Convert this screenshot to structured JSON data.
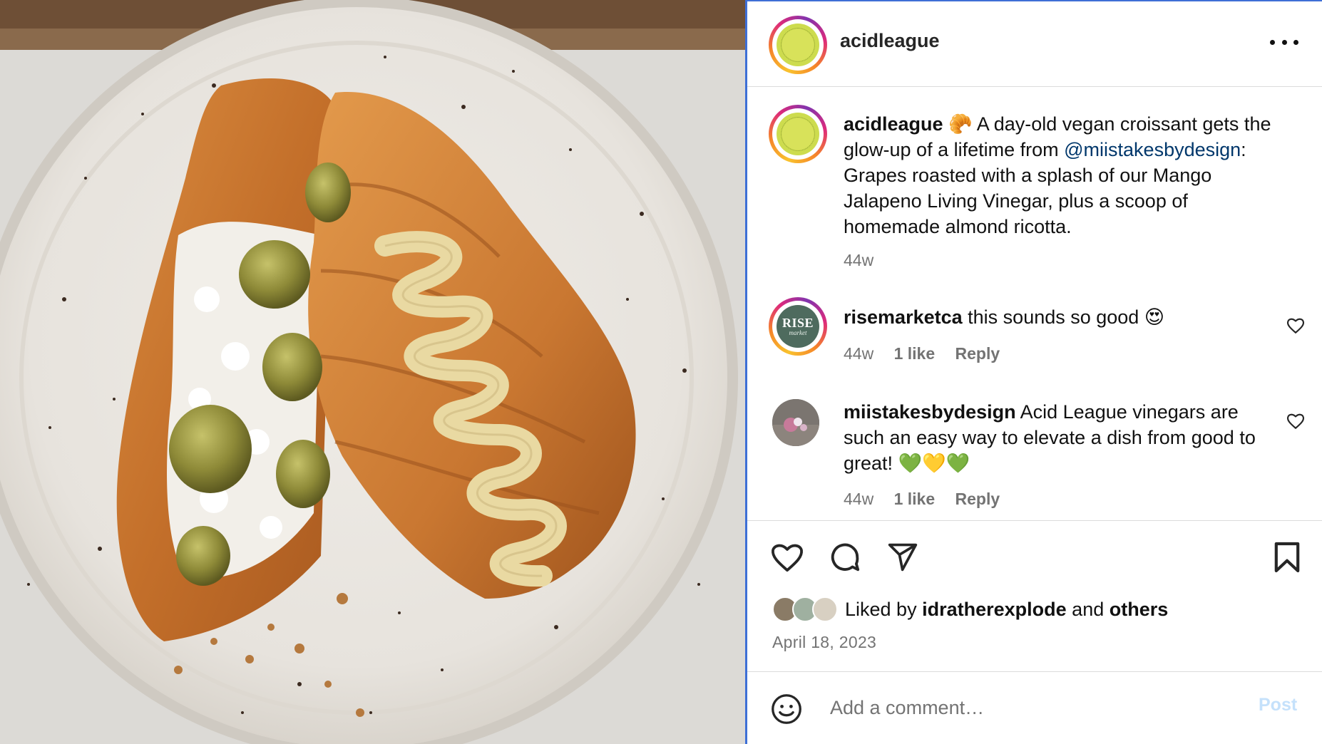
{
  "post": {
    "username": "acidleague",
    "caption_emoji": "🥐",
    "caption_part1": "A day-old vegan croissant gets the glow-up of a lifetime from",
    "caption_mention": "@miistakesbydesign",
    "caption_part2": ": Grapes roasted with a splash of our Mango Jalapeno Living Vinegar, plus a scoop of homemade almond ricotta.",
    "age": "44w"
  },
  "comments": [
    {
      "username": "risemarketca",
      "text": "this sounds so good",
      "emoji": "😍",
      "avatar_text": "RISE",
      "avatar_subtext": "market",
      "age": "44w",
      "likes": "1 like",
      "reply": "Reply"
    },
    {
      "username": "miistakesbydesign",
      "text": "Acid League vinegars are such an easy way to elevate a dish from good to great!",
      "emoji": "💚💛💚",
      "age": "44w",
      "likes": "1 like",
      "reply": "Reply"
    }
  ],
  "likes": {
    "prefix": "Liked by",
    "user": "idratherexplode",
    "conj": "and",
    "others": "others"
  },
  "date": "April 18, 2023",
  "comment_box": {
    "placeholder": "Add a comment…",
    "post_label": "Post"
  },
  "icons": {
    "more": "more-horizontal-icon",
    "like": "heart-icon",
    "comment": "comment-bubble-icon",
    "share": "paper-plane-icon",
    "save": "bookmark-icon",
    "emoji": "smiley-icon"
  },
  "colors": {
    "accent_focus": "#3e6fd6",
    "mention": "#00376b",
    "secondary_text": "#737373",
    "post_button_disabled": "#c5e1fb",
    "acid_avatar": "#d8e25a",
    "rise_avatar": "#4e6b5e"
  }
}
